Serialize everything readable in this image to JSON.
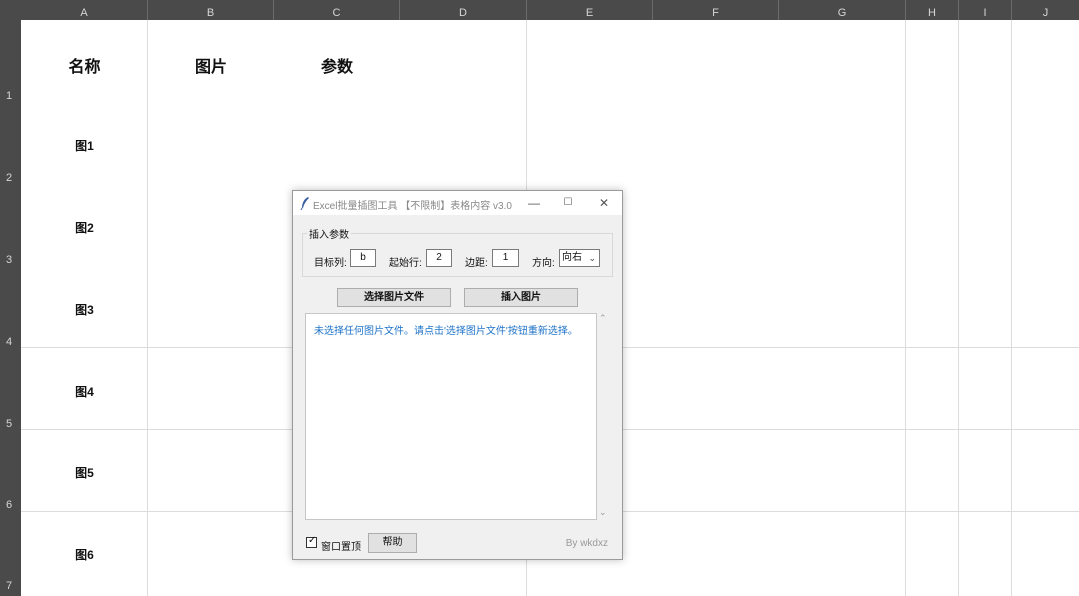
{
  "sheet": {
    "columns": [
      "A",
      "B",
      "C",
      "D",
      "E",
      "F",
      "G",
      "H",
      "I",
      "J"
    ],
    "rows": [
      "1",
      "2",
      "3",
      "4",
      "5",
      "6",
      "7"
    ],
    "header_cells": {
      "a1": "名称",
      "b1": "图片",
      "c1": "参数"
    },
    "names": [
      "图1",
      "图2",
      "图3",
      "图4",
      "图5",
      "图6"
    ]
  },
  "dialog": {
    "title": "Excel批量插图工具 【不限制】表格内容 v3.0",
    "minimize": "—",
    "maximize": "☐",
    "close": "✕",
    "group_title": "插入参数",
    "fields": {
      "target_col_label": "目标列:",
      "target_col_value": "b",
      "start_row_label": "起始行:",
      "start_row_value": "2",
      "margin_label": "边距:",
      "margin_value": "1",
      "direction_label": "方向:",
      "direction_value": "向右"
    },
    "buttons": {
      "select_files": "选择图片文件",
      "insert_images": "插入图片",
      "help": "帮助"
    },
    "log_text": "未选择任何图片文件。请点击'选择图片文件'按钮重新选择。",
    "topmost_label": "窗口置顶",
    "topmost_checked": true,
    "byline": "By wkdxz"
  },
  "colors": {
    "log_text": "#1e73c8",
    "header_bg": "#4a4a4a"
  }
}
